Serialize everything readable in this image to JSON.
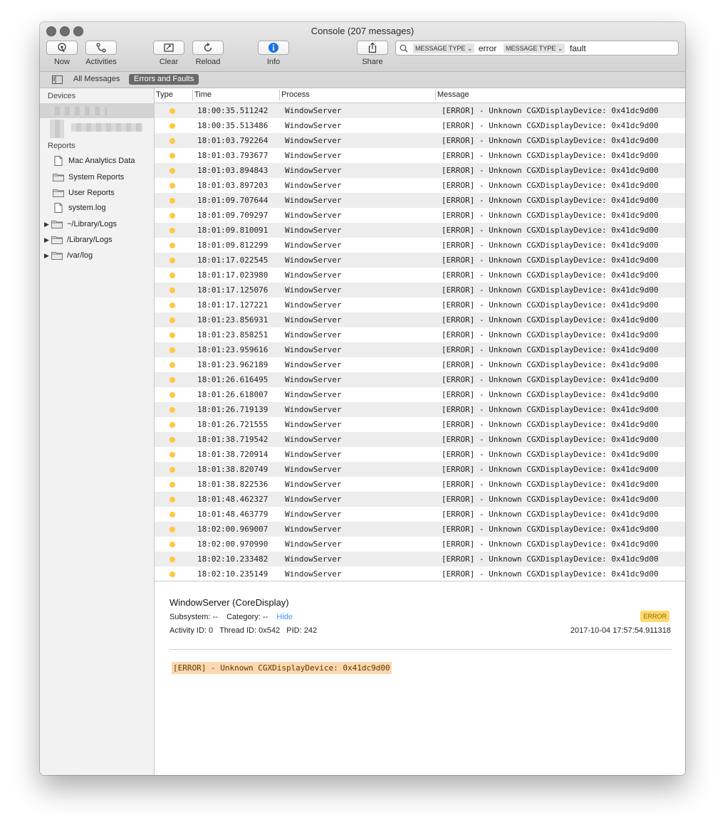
{
  "window": {
    "title": "Console (207 messages)"
  },
  "toolbar": {
    "now_label": "Now",
    "activities_label": "Activities",
    "clear_label": "Clear",
    "reload_label": "Reload",
    "info_label": "Info",
    "share_label": "Share"
  },
  "search": {
    "tokens": [
      {
        "type": "MESSAGE TYPE",
        "value": "error"
      },
      {
        "type": "MESSAGE TYPE",
        "value": "fault"
      }
    ]
  },
  "filters": {
    "all_messages": "All Messages",
    "errors_and_faults": "Errors and Faults",
    "selected": "Errors and Faults"
  },
  "sidebar": {
    "devices_header": "Devices",
    "reports_header": "Reports",
    "items": [
      {
        "label": "Mac Analytics Data",
        "icon": "document-icon"
      },
      {
        "label": "System Reports",
        "icon": "folder-icon"
      },
      {
        "label": "User Reports",
        "icon": "folder-icon"
      },
      {
        "label": "system.log",
        "icon": "document-icon"
      },
      {
        "label": "~/Library/Logs",
        "icon": "folder-icon"
      },
      {
        "label": "/Library/Logs",
        "icon": "folder-icon"
      },
      {
        "label": "/var/log",
        "icon": "folder-icon"
      }
    ]
  },
  "table": {
    "columns": [
      "Type",
      "Time",
      "Process",
      "Message"
    ],
    "rows": [
      {
        "time": "18:00:35.511242",
        "process": "WindowServer",
        "message": "[ERROR] - Unknown CGXDisplayDevice: 0x41dc9d00"
      },
      {
        "time": "18:00:35.513486",
        "process": "WindowServer",
        "message": "[ERROR] - Unknown CGXDisplayDevice: 0x41dc9d00"
      },
      {
        "time": "18:01:03.792264",
        "process": "WindowServer",
        "message": "[ERROR] - Unknown CGXDisplayDevice: 0x41dc9d00"
      },
      {
        "time": "18:01:03.793677",
        "process": "WindowServer",
        "message": "[ERROR] - Unknown CGXDisplayDevice: 0x41dc9d00"
      },
      {
        "time": "18:01:03.894843",
        "process": "WindowServer",
        "message": "[ERROR] - Unknown CGXDisplayDevice: 0x41dc9d00"
      },
      {
        "time": "18:01:03.897203",
        "process": "WindowServer",
        "message": "[ERROR] - Unknown CGXDisplayDevice: 0x41dc9d00"
      },
      {
        "time": "18:01:09.707644",
        "process": "WindowServer",
        "message": "[ERROR] - Unknown CGXDisplayDevice: 0x41dc9d00"
      },
      {
        "time": "18:01:09.709297",
        "process": "WindowServer",
        "message": "[ERROR] - Unknown CGXDisplayDevice: 0x41dc9d00"
      },
      {
        "time": "18:01:09.810091",
        "process": "WindowServer",
        "message": "[ERROR] - Unknown CGXDisplayDevice: 0x41dc9d00"
      },
      {
        "time": "18:01:09.812299",
        "process": "WindowServer",
        "message": "[ERROR] - Unknown CGXDisplayDevice: 0x41dc9d00"
      },
      {
        "time": "18:01:17.022545",
        "process": "WindowServer",
        "message": "[ERROR] - Unknown CGXDisplayDevice: 0x41dc9d00"
      },
      {
        "time": "18:01:17.023980",
        "process": "WindowServer",
        "message": "[ERROR] - Unknown CGXDisplayDevice: 0x41dc9d00"
      },
      {
        "time": "18:01:17.125076",
        "process": "WindowServer",
        "message": "[ERROR] - Unknown CGXDisplayDevice: 0x41dc9d00"
      },
      {
        "time": "18:01:17.127221",
        "process": "WindowServer",
        "message": "[ERROR] - Unknown CGXDisplayDevice: 0x41dc9d00"
      },
      {
        "time": "18:01:23.856931",
        "process": "WindowServer",
        "message": "[ERROR] - Unknown CGXDisplayDevice: 0x41dc9d00"
      },
      {
        "time": "18:01:23.858251",
        "process": "WindowServer",
        "message": "[ERROR] - Unknown CGXDisplayDevice: 0x41dc9d00"
      },
      {
        "time": "18:01:23.959616",
        "process": "WindowServer",
        "message": "[ERROR] - Unknown CGXDisplayDevice: 0x41dc9d00"
      },
      {
        "time": "18:01:23.962189",
        "process": "WindowServer",
        "message": "[ERROR] - Unknown CGXDisplayDevice: 0x41dc9d00"
      },
      {
        "time": "18:01:26.616495",
        "process": "WindowServer",
        "message": "[ERROR] - Unknown CGXDisplayDevice: 0x41dc9d00"
      },
      {
        "time": "18:01:26.618007",
        "process": "WindowServer",
        "message": "[ERROR] - Unknown CGXDisplayDevice: 0x41dc9d00"
      },
      {
        "time": "18:01:26.719139",
        "process": "WindowServer",
        "message": "[ERROR] - Unknown CGXDisplayDevice: 0x41dc9d00"
      },
      {
        "time": "18:01:26.721555",
        "process": "WindowServer",
        "message": "[ERROR] - Unknown CGXDisplayDevice: 0x41dc9d00"
      },
      {
        "time": "18:01:38.719542",
        "process": "WindowServer",
        "message": "[ERROR] - Unknown CGXDisplayDevice: 0x41dc9d00"
      },
      {
        "time": "18:01:38.720914",
        "process": "WindowServer",
        "message": "[ERROR] - Unknown CGXDisplayDevice: 0x41dc9d00"
      },
      {
        "time": "18:01:38.820749",
        "process": "WindowServer",
        "message": "[ERROR] - Unknown CGXDisplayDevice: 0x41dc9d00"
      },
      {
        "time": "18:01:38.822536",
        "process": "WindowServer",
        "message": "[ERROR] - Unknown CGXDisplayDevice: 0x41dc9d00"
      },
      {
        "time": "18:01:48.462327",
        "process": "WindowServer",
        "message": "[ERROR] - Unknown CGXDisplayDevice: 0x41dc9d00"
      },
      {
        "time": "18:01:48.463779",
        "process": "WindowServer",
        "message": "[ERROR] - Unknown CGXDisplayDevice: 0x41dc9d00"
      },
      {
        "time": "18:02:00.969007",
        "process": "WindowServer",
        "message": "[ERROR] - Unknown CGXDisplayDevice: 0x41dc9d00"
      },
      {
        "time": "18:02:00.970990",
        "process": "WindowServer",
        "message": "[ERROR] - Unknown CGXDisplayDevice: 0x41dc9d00"
      },
      {
        "time": "18:02:10.233482",
        "process": "WindowServer",
        "message": "[ERROR] - Unknown CGXDisplayDevice: 0x41dc9d00"
      },
      {
        "time": "18:02:10.235149",
        "process": "WindowServer",
        "message": "[ERROR] - Unknown CGXDisplayDevice: 0x41dc9d00"
      }
    ]
  },
  "detail": {
    "title": "WindowServer (CoreDisplay)",
    "subsystem_label": "Subsystem: --",
    "category_label": "Category: --",
    "hide_label": "Hide",
    "badge": "ERROR",
    "activity_line": "Activity ID: 0   Thread ID: 0x542   PID: 242",
    "timestamp": "2017-10-04 17:57:54.911318",
    "message": "[ERROR] - Unknown CGXDisplayDevice: 0x41dc9d00"
  },
  "colors": {
    "error_dot": "#ffc83d",
    "error_badge": "#ffd96b",
    "message_highlight": "#fcd7b1",
    "accent": "#3b99fc",
    "selected_filter": "#6a6a6a"
  }
}
